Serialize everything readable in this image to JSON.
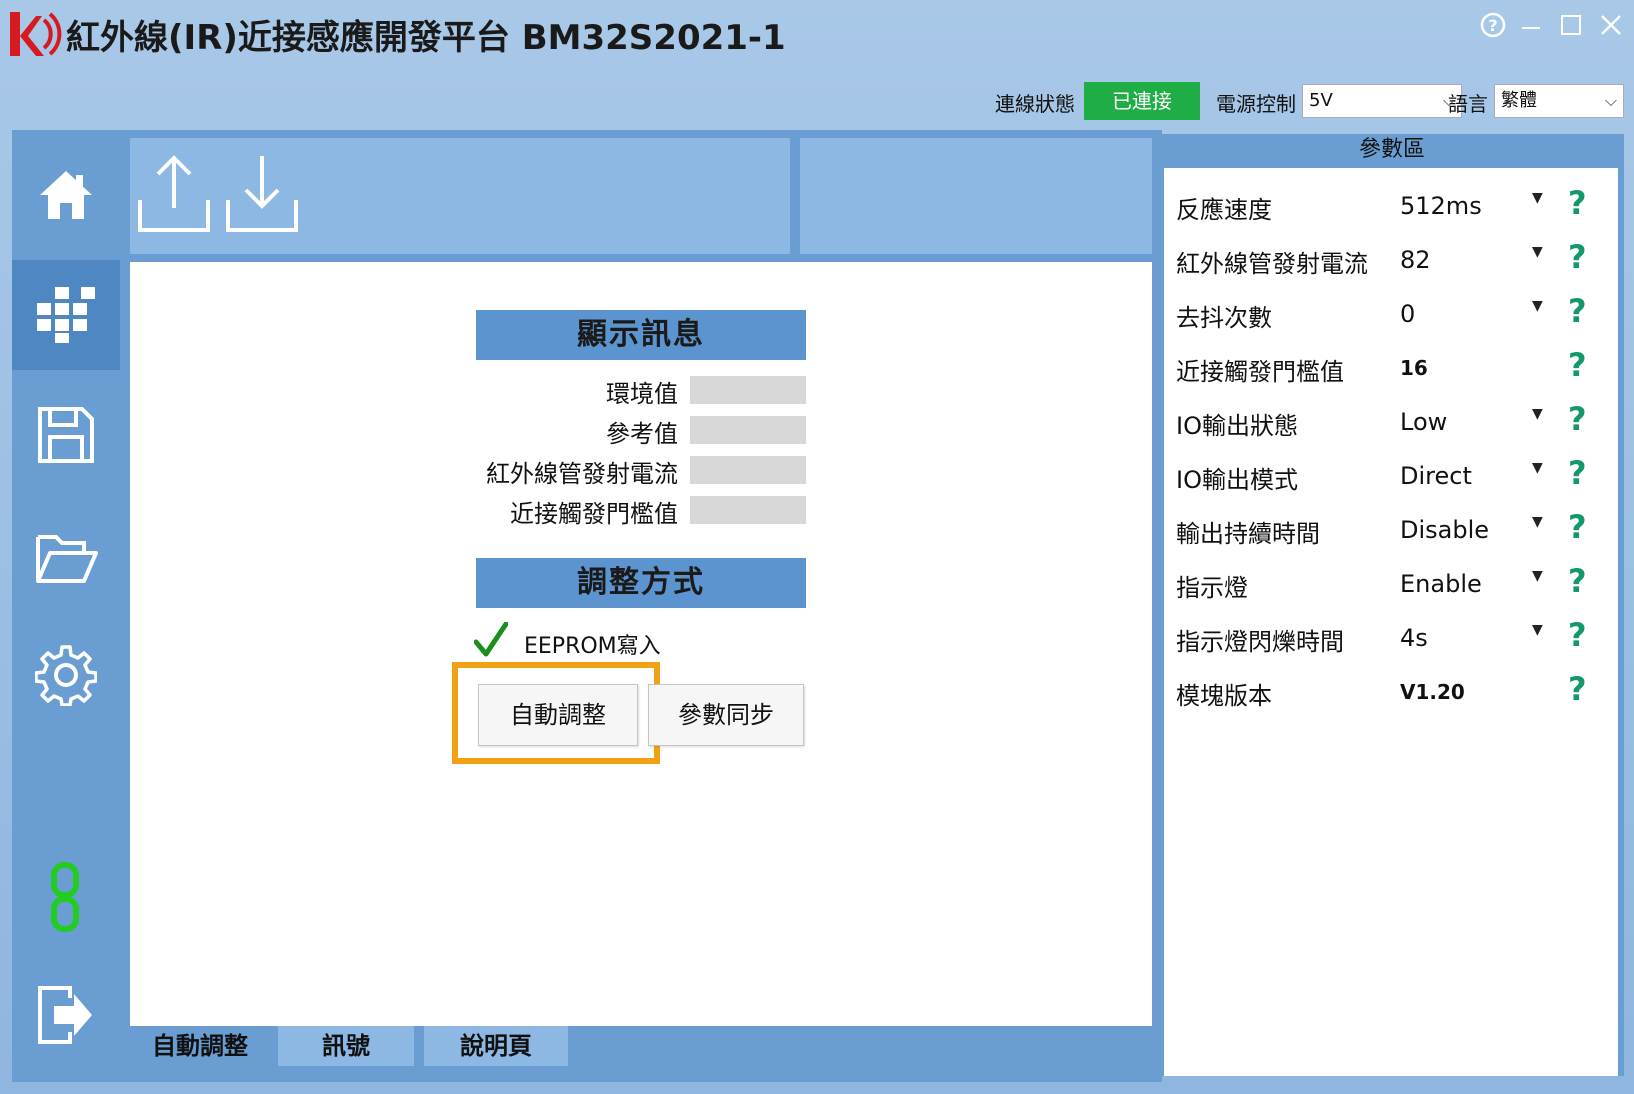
{
  "app": {
    "title": "紅外線(IR)近接感應開發平台 BM32S2021-1"
  },
  "status_bar": {
    "connection_label": "連線狀態",
    "connection_status": "已連接",
    "power_label": "電源控制",
    "power_value": "5V",
    "language_label": "語言",
    "language_value": "繁體"
  },
  "display_info": {
    "header": "顯示訊息",
    "rows": [
      {
        "label": "環境值"
      },
      {
        "label": "參考值"
      },
      {
        "label": "紅外線管發射電流"
      },
      {
        "label": "近接觸發門檻值"
      }
    ]
  },
  "adjust": {
    "header": "調整方式",
    "eeprom_label": "EEPROM寫入",
    "auto_button": "自動調整",
    "sync_button": "參數同步"
  },
  "tabs": [
    {
      "label": "自動調整"
    },
    {
      "label": "訊號"
    },
    {
      "label": "說明頁"
    }
  ],
  "params": {
    "title": "參數區",
    "items": [
      {
        "name": "反應速度",
        "value": "512ms",
        "dropdown": true
      },
      {
        "name": "紅外線管發射電流",
        "value": "82",
        "dropdown": true
      },
      {
        "name": "去抖次數",
        "value": "0",
        "dropdown": true
      },
      {
        "name": "近接觸發門檻值",
        "value": "16",
        "dropdown": false
      },
      {
        "name": "IO輸出狀態",
        "value": "Low",
        "dropdown": true
      },
      {
        "name": "IO輸出模式",
        "value": "Direct",
        "dropdown": true
      },
      {
        "name": "輸出持續時間",
        "value": "Disable",
        "dropdown": true
      },
      {
        "name": "指示燈",
        "value": "Enable",
        "dropdown": true
      },
      {
        "name": "指示燈閃爍時間",
        "value": "4s",
        "dropdown": true
      },
      {
        "name": "模塊版本",
        "value": "V1.20",
        "dropdown": false
      }
    ],
    "help_glyph": "?"
  },
  "colors": {
    "connected": "#1fad45",
    "highlight": "#f4a015",
    "header_blue": "#5b94cf",
    "help_green": "#14986a",
    "link_green": "#22cc22"
  },
  "icons": [
    "home-icon",
    "modules-icon",
    "save-icon",
    "open-folder-icon",
    "gear-icon",
    "link-icon",
    "exit-icon",
    "upload-icon",
    "download-icon",
    "help-icon",
    "minimize-icon",
    "maximize-icon",
    "close-icon",
    "check-icon",
    "chevron-down-icon"
  ]
}
